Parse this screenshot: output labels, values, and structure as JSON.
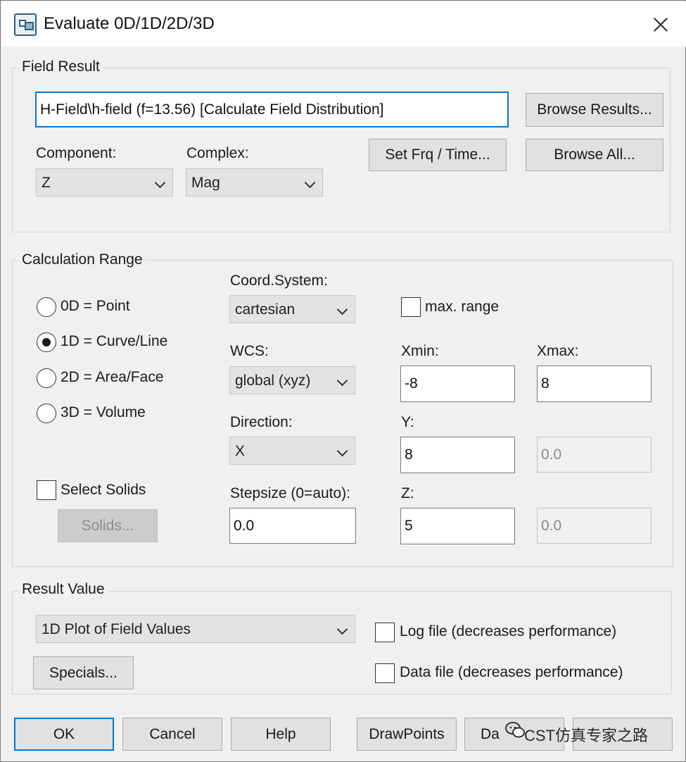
{
  "window": {
    "title": "Evaluate 0D/1D/2D/3D"
  },
  "field_result": {
    "group_label": "Field Result",
    "field_value": "H-Field\\h-field (f=13.56) [Calculate Field Distribution]",
    "browse_results_label": "Browse Results...",
    "browse_all_label": "Browse All...",
    "set_frq_label": "Set Frq / Time...",
    "component_label": "Component:",
    "component_value": "Z",
    "complex_label": "Complex:",
    "complex_value": "Mag"
  },
  "calculation_range": {
    "group_label": "Calculation Range",
    "radios": [
      {
        "label": "0D = Point",
        "checked": false
      },
      {
        "label": "1D = Curve/Line",
        "checked": true
      },
      {
        "label": "2D = Area/Face",
        "checked": false
      },
      {
        "label": "3D = Volume",
        "checked": false
      }
    ],
    "select_solids_label": "Select Solids",
    "solids_button_label": "Solids...",
    "coord_system_label": "Coord.System:",
    "coord_system_value": "cartesian",
    "wcs_label": "WCS:",
    "wcs_value": "global (xyz)",
    "direction_label": "Direction:",
    "direction_value": "X",
    "stepsize_label": "Stepsize (0=auto):",
    "stepsize_value": "0.0",
    "max_range_label": "max. range",
    "xmin_label": "Xmin:",
    "xmin_value": "-8",
    "xmax_label": "Xmax:",
    "xmax_value": "8",
    "y_label": "Y:",
    "y_value": "8",
    "y_max_value": "0.0",
    "z_label": "Z:",
    "z_value": "5",
    "z_max_value": "0.0"
  },
  "result_value": {
    "group_label": "Result Value",
    "plot_value": "1D Plot of Field Values",
    "specials_label": "Specials...",
    "log_file_label": "Log file (decreases performance)",
    "data_file_label": "Data file (decreases performance)"
  },
  "footer": {
    "ok_label": "OK",
    "cancel_label": "Cancel",
    "help_label": "Help",
    "drawpoints_label": "DrawPoints",
    "data_label": "Da"
  },
  "watermark": {
    "text": "CST仿真专家之路"
  }
}
